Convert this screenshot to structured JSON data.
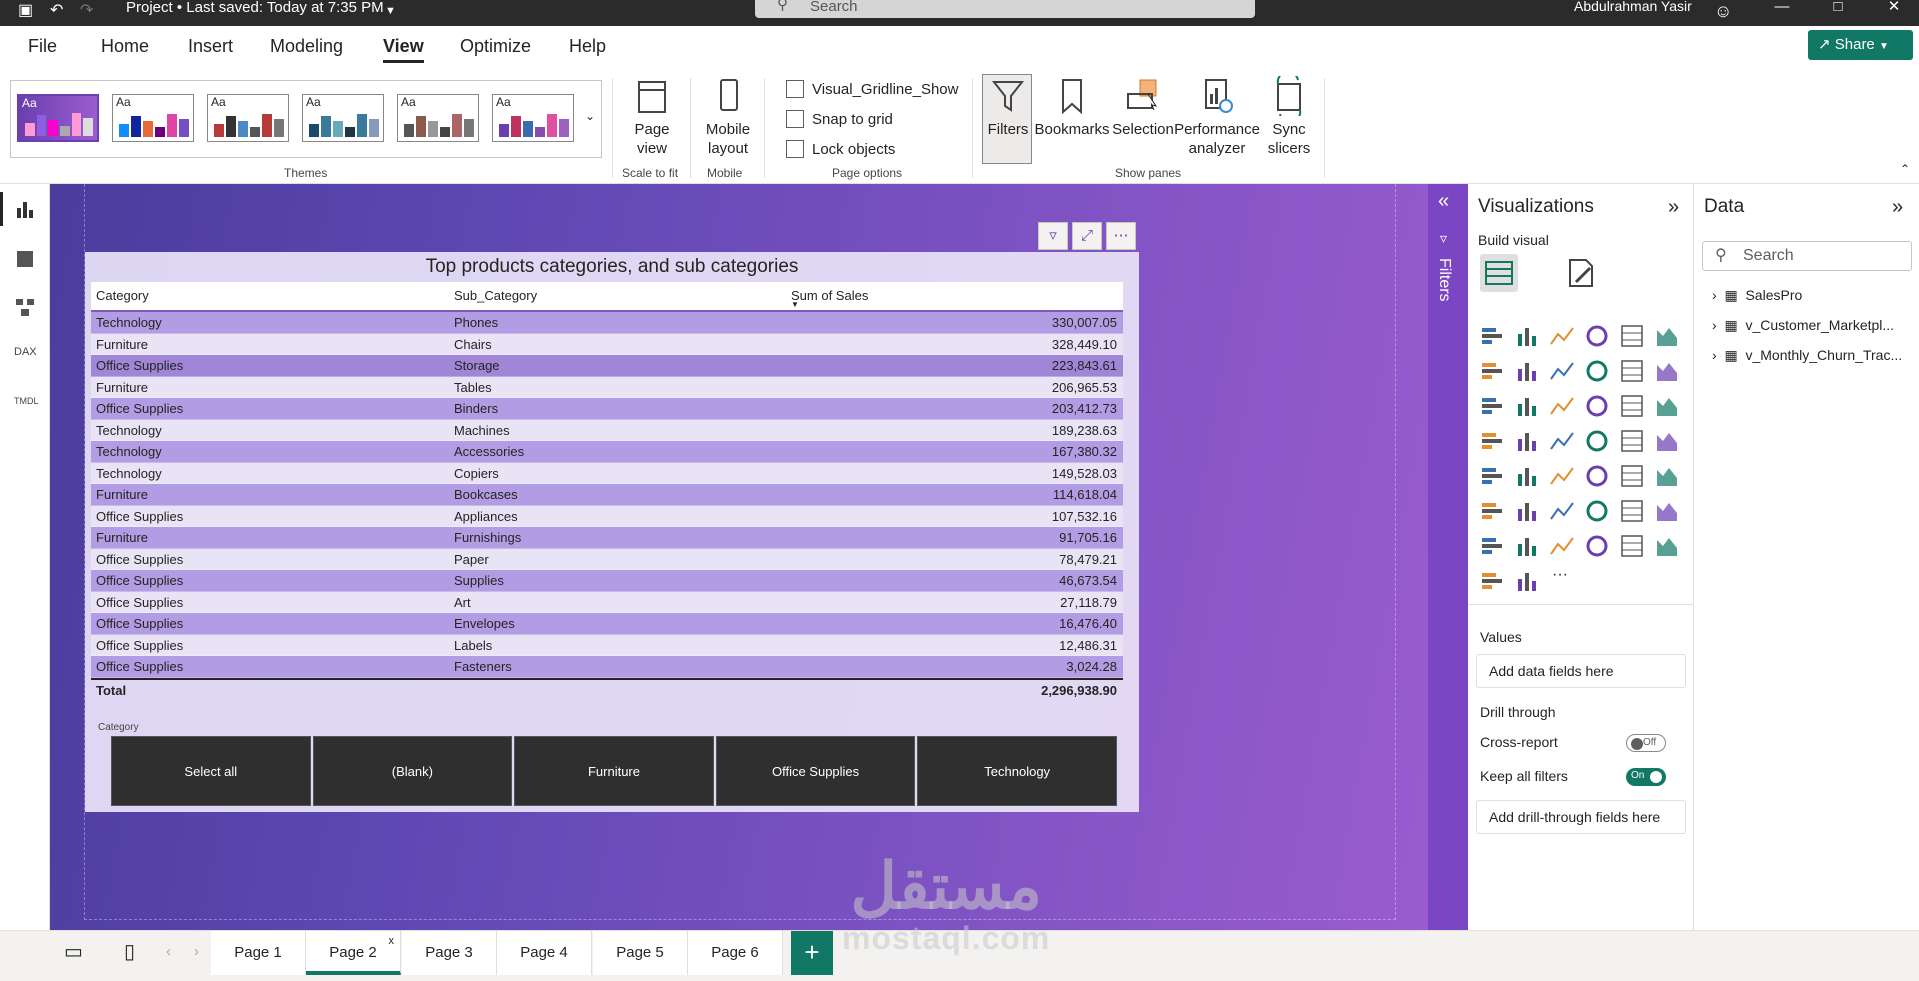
{
  "titlebar": {
    "title": "Project • Last saved: Today at 7:35 PM",
    "search_placeholder": "Search",
    "user": "Abdulrahman Yasir"
  },
  "menu": {
    "items": [
      "File",
      "Home",
      "Insert",
      "Modeling",
      "View",
      "Optimize",
      "Help"
    ],
    "active": "View",
    "share_label": "Share"
  },
  "ribbon": {
    "themes_label": "Themes",
    "theme_text": "Aa",
    "page_view": "Page view",
    "scale_to_fit": "Scale to fit",
    "mobile_layout": "Mobile layout",
    "mobile": "Mobile",
    "checks": [
      "Visual_Gridline_Show",
      "Snap to grid",
      "Lock objects"
    ],
    "page_options": "Page options",
    "panes": [
      "Filters",
      "Bookmarks",
      "Selection",
      "Performance analyzer",
      "Sync slicers"
    ],
    "show_panes": "Show panes"
  },
  "visual": {
    "title": "Top products categories, and sub categories",
    "columns": [
      "Category",
      "Sub_Category",
      "Sum of Sales"
    ],
    "rows": [
      [
        "Technology",
        "Phones",
        "330,007.05"
      ],
      [
        "Furniture",
        "Chairs",
        "328,449.10"
      ],
      [
        "Office Supplies",
        "Storage",
        "223,843.61"
      ],
      [
        "Furniture",
        "Tables",
        "206,965.53"
      ],
      [
        "Office Supplies",
        "Binders",
        "203,412.73"
      ],
      [
        "Technology",
        "Machines",
        "189,238.63"
      ],
      [
        "Technology",
        "Accessories",
        "167,380.32"
      ],
      [
        "Technology",
        "Copiers",
        "149,528.03"
      ],
      [
        "Furniture",
        "Bookcases",
        "114,618.04"
      ],
      [
        "Office Supplies",
        "Appliances",
        "107,532.16"
      ],
      [
        "Furniture",
        "Furnishings",
        "91,705.16"
      ],
      [
        "Office Supplies",
        "Paper",
        "78,479.21"
      ],
      [
        "Office Supplies",
        "Supplies",
        "46,673.54"
      ],
      [
        "Office Supplies",
        "Art",
        "27,118.79"
      ],
      [
        "Office Supplies",
        "Envelopes",
        "16,476.40"
      ],
      [
        "Office Supplies",
        "Labels",
        "12,486.31"
      ],
      [
        "Office Supplies",
        "Fasteners",
        "3,024.28"
      ]
    ],
    "total_label": "Total",
    "total_value": "2,296,938.90",
    "slicer_label": "Category",
    "slicer_items": [
      "Select all",
      "(Blank)",
      "Furniture",
      "Office Supplies",
      "Technology"
    ]
  },
  "filters_pane": {
    "label": "Filters"
  },
  "viz_pane": {
    "title": "Visualizations",
    "build_visual": "Build visual",
    "values_label": "Values",
    "values_placeholder": "Add data fields here",
    "drill_through": "Drill through",
    "cross_report": "Cross-report",
    "cross_report_state": "Off",
    "keep_all_filters": "Keep all filters",
    "keep_all_filters_state": "On",
    "drill_placeholder": "Add drill-through fields here",
    "more": "···"
  },
  "data_pane": {
    "title": "Data",
    "search_placeholder": "Search",
    "tables": [
      "SalesPro",
      "v_Customer_Marketpl...",
      "v_Monthly_Churn_Trac..."
    ]
  },
  "pages": {
    "tabs": [
      "Page 1",
      "Page 2",
      "Page 3",
      "Page 4",
      "Page 5",
      "Page 6"
    ],
    "active": "Page 2",
    "close": "x",
    "add": "+"
  },
  "watermark": {
    "arabic": "مستقل",
    "latin": "mostaql.com"
  },
  "colors": {
    "accent": "#117865",
    "brand_purple": "#7b46c4",
    "row_band": "#b29ce3"
  }
}
